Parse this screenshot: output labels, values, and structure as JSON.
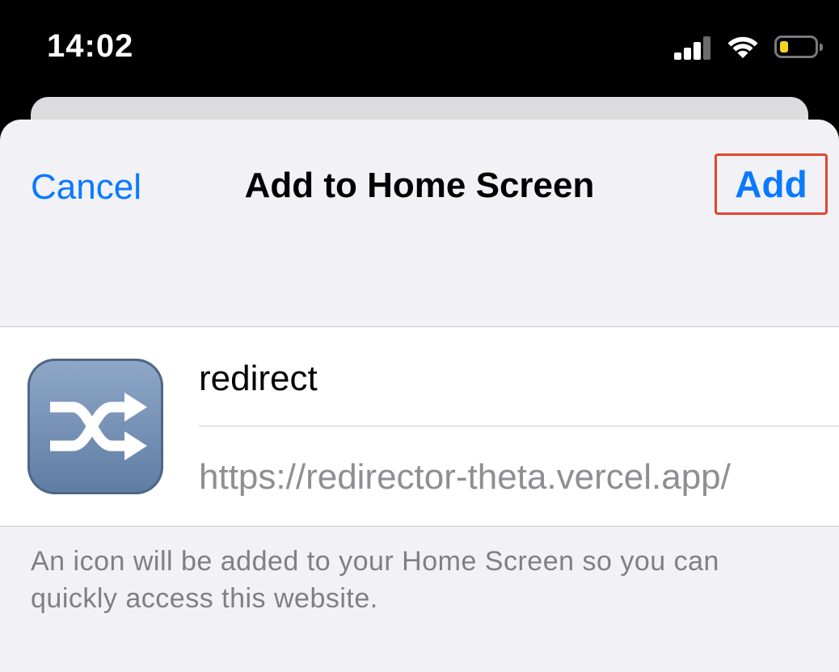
{
  "status_bar": {
    "time": "14:02",
    "signal_icon": "cellular-signal-icon",
    "wifi_icon": "wifi-icon",
    "battery_icon": "battery-low-icon",
    "battery_level": 0.25,
    "battery_color": "#f7d51f"
  },
  "nav": {
    "cancel_label": "Cancel",
    "title": "Add to Home Screen",
    "add_label": "Add",
    "accent_color": "#0a7aff",
    "highlight_color": "#e0472f"
  },
  "shortcut": {
    "icon": "shuffle-arrows-icon",
    "name_value": "redirect",
    "url": "https://redirector-theta.vercel.app/"
  },
  "helper_text": "An icon will be added to your Home Screen so you can quickly access this website."
}
